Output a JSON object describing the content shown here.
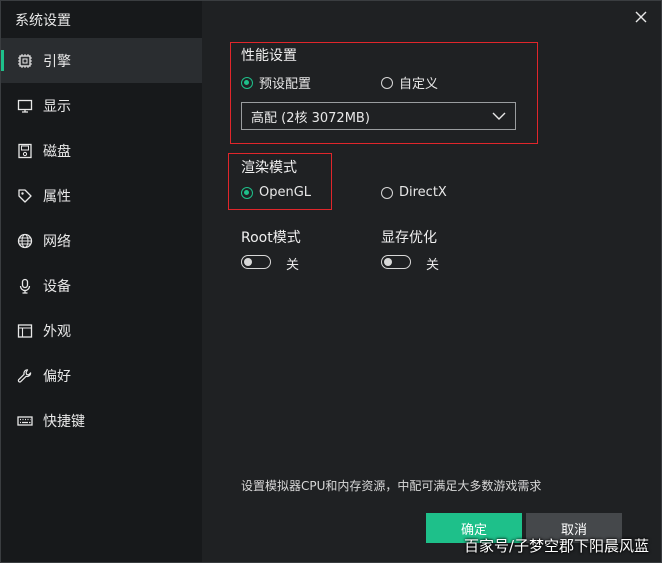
{
  "window": {
    "title": "系统设置"
  },
  "sidebar": {
    "items": [
      {
        "label": "引擎",
        "icon": "chip-icon",
        "active": true
      },
      {
        "label": "显示",
        "icon": "monitor-icon",
        "active": false
      },
      {
        "label": "磁盘",
        "icon": "disk-icon",
        "active": false
      },
      {
        "label": "属性",
        "icon": "tag-icon",
        "active": false
      },
      {
        "label": "网络",
        "icon": "globe-icon",
        "active": false
      },
      {
        "label": "设备",
        "icon": "microphone-icon",
        "active": false
      },
      {
        "label": "外观",
        "icon": "window-icon",
        "active": false
      },
      {
        "label": "偏好",
        "icon": "wrench-icon",
        "active": false
      },
      {
        "label": "快捷键",
        "icon": "keyboard-icon",
        "active": false
      }
    ]
  },
  "performance": {
    "title": "性能设置",
    "option_preset": "预设配置",
    "option_custom": "自定义",
    "selected": "preset",
    "preset_value": "高配 (2核 3072MB)"
  },
  "render": {
    "title": "渲染模式",
    "option_opengl": "OpenGL",
    "option_directx": "DirectX",
    "selected": "opengl"
  },
  "root_mode": {
    "label": "Root模式",
    "state": "关",
    "on": false
  },
  "vram_opt": {
    "label": "显存优化",
    "state": "关",
    "on": false
  },
  "hint": "设置模拟器CPU和内存资源，中配可满足大多数游戏需求",
  "buttons": {
    "ok": "确定",
    "cancel": "取消"
  },
  "watermark": "百家号/子梦空郡下阳晨风蓝",
  "colors": {
    "accent": "#1ec08a",
    "highlight_box": "#e0262b",
    "sidebar_bg": "#17191b",
    "panel_bg": "#1f2123"
  }
}
